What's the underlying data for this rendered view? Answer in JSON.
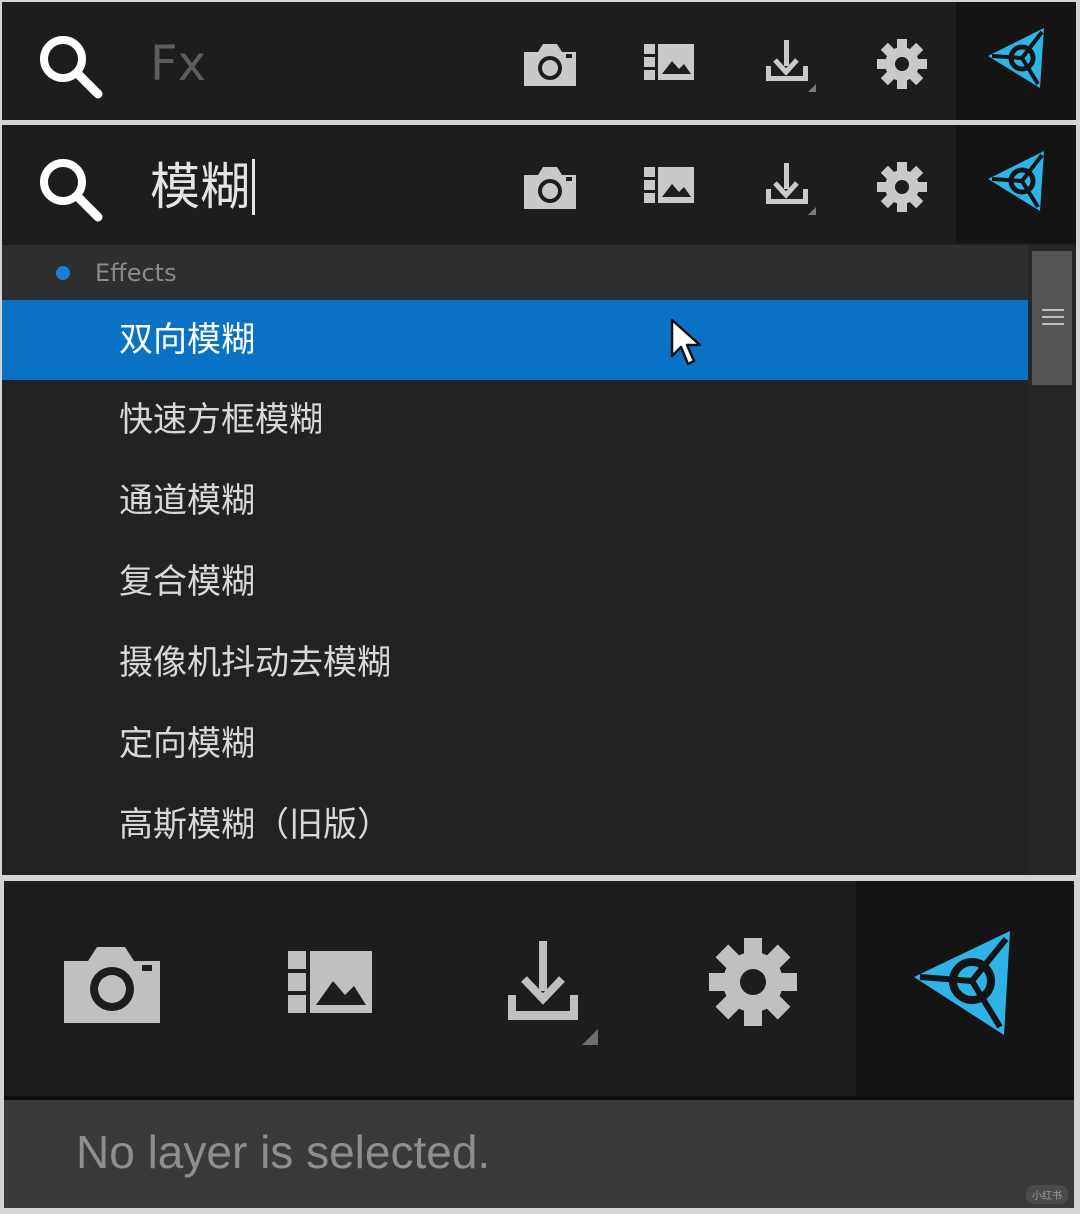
{
  "panel1": {
    "search_placeholder": "Fx"
  },
  "panel2": {
    "search_value": "模糊",
    "group": {
      "label": "Effects",
      "dot_color": "#1a7fd4"
    },
    "items": [
      {
        "label": "双向模糊",
        "selected": true
      },
      {
        "label": "快速方框模糊"
      },
      {
        "label": "通道模糊"
      },
      {
        "label": "复合模糊"
      },
      {
        "label": "摄像机抖动去模糊"
      },
      {
        "label": "定向模糊"
      },
      {
        "label": "高斯模糊（旧版）"
      }
    ]
  },
  "panel3": {
    "status": "No layer is selected."
  },
  "icons": {
    "search": "search-icon",
    "camera": "camera-icon",
    "image_sequence": "image-sequence-icon",
    "download": "download-icon",
    "settings": "gear-icon",
    "logo": "logo-icon"
  },
  "colors": {
    "accent": "#0a72c4",
    "logo": "#2fb3e6",
    "background": "#1d1d1d"
  },
  "watermark": "小红书"
}
